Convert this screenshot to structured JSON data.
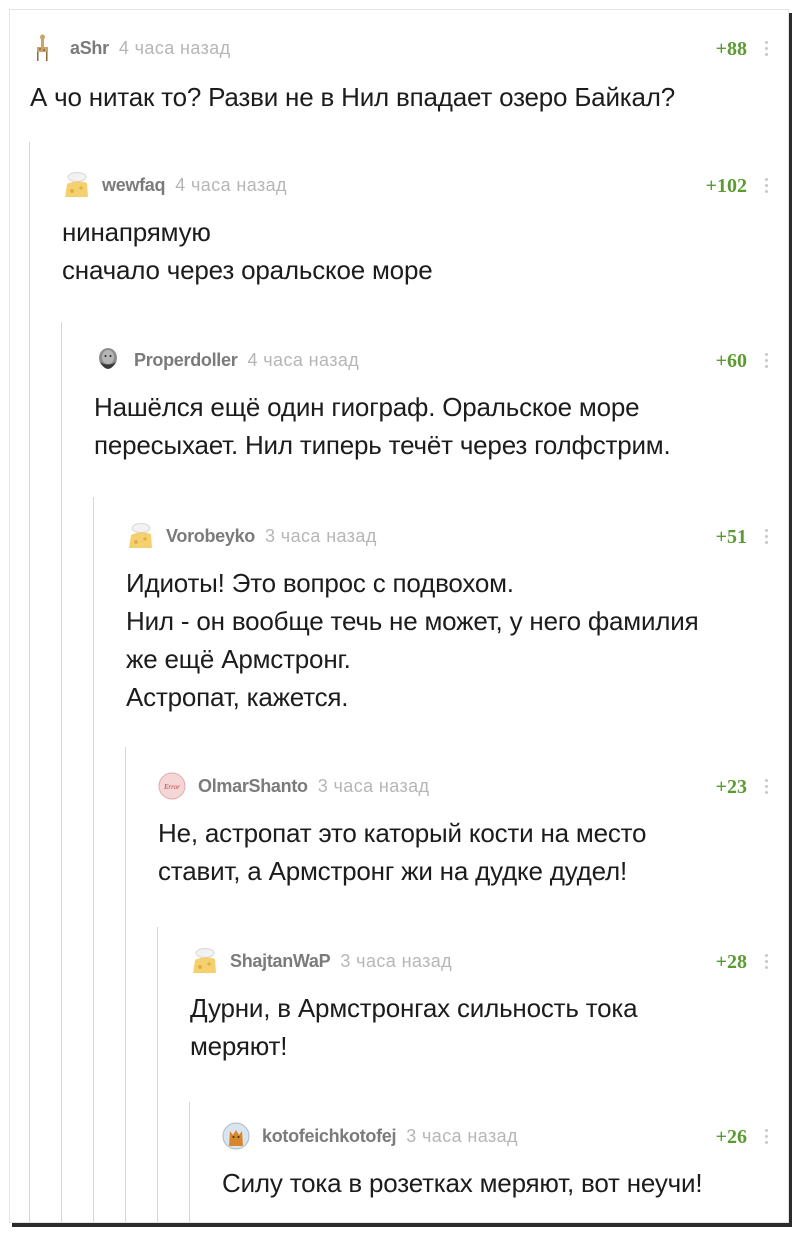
{
  "comments": [
    {
      "author": "aShr",
      "time": "4 часа назад",
      "score": "+88",
      "avatar_icon": "giraffe-avatar-icon",
      "lines": [
        "А чо нитак то? Разви не в Нил впадает озеро Байкал?"
      ]
    },
    {
      "author": "wewfaq",
      "time": "4 часа назад",
      "score": "+102",
      "avatar_icon": "default-cheese-avatar-icon",
      "lines": [
        "нинапрямую",
        "сначало через оральское море"
      ]
    },
    {
      "author": "Properdoller",
      "time": "4 часа назад",
      "score": "+60",
      "avatar_icon": "bearded-man-avatar-icon",
      "lines": [
        "Нашёлся ещё один гиограф. Оральское море",
        "пересыхает. Нил типерь течёт через голфстрим."
      ]
    },
    {
      "author": "Vorobeyko",
      "time": "3 часа назад",
      "score": "+51",
      "avatar_icon": "default-cheese-avatar-icon",
      "lines": [
        "Идиоты! Это вопрос с подвохом.",
        "Нил - он вообще течь не может, у него фамилия",
        "же ещё Армстронг.",
        "Астропат, кажется."
      ]
    },
    {
      "author": "OlmarShanto",
      "time": "3 часа назад",
      "score": "+23",
      "avatar_icon": "error-avatar-icon",
      "avatar_text": "Error",
      "lines": [
        "Не, астропат это каторый кости на место",
        "ставит, а Армстронг жи на дудке дудел!"
      ]
    },
    {
      "author": "ShajtanWaP",
      "time": "3 часа назад",
      "score": "+28",
      "avatar_icon": "default-cheese-avatar-icon",
      "lines": [
        "Дурни, в Армстронгах сильность тока",
        "меряют!"
      ]
    },
    {
      "author": "kotofeichkotofej",
      "time": "3 часа назад",
      "score": "+26",
      "avatar_icon": "cat-avatar-icon",
      "lines": [
        "Силу тока в розетках меряют, вот неучи!"
      ]
    }
  ],
  "colors": {
    "score": "#5c9b31",
    "author": "#7b7b7b",
    "time": "#b6b6b6",
    "thread_line": "#d6d6d6"
  }
}
